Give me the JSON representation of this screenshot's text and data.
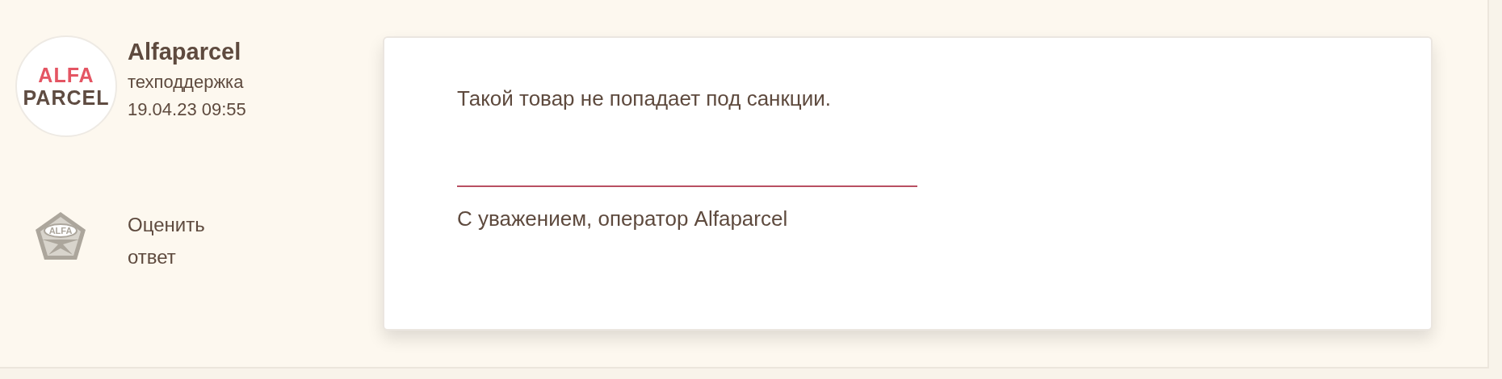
{
  "author": {
    "logo_lines": [
      "ALFA",
      "PARCEL"
    ],
    "name": "Alfaparcel",
    "role": "техподдержка",
    "timestamp": "19.04.23 09:55"
  },
  "rate": {
    "badge_text": "ALFA",
    "label_lines": [
      "Оценить",
      "ответ"
    ]
  },
  "message": {
    "text": "Такой товар не попадает под санкции.",
    "signature": "С уважением, оператор Alfaparcel"
  }
}
